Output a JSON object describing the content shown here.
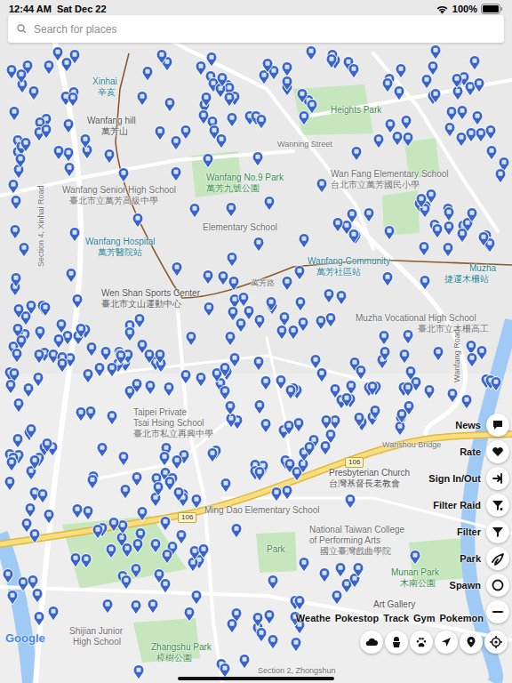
{
  "status_bar": {
    "time": "12:44 AM",
    "date": "Sat Dec 22",
    "battery": "100%"
  },
  "search": {
    "placeholder": "Search for places"
  },
  "map": {
    "labels": [
      {
        "text": "Xinhai",
        "kind": "station"
      },
      {
        "text": "辛亥",
        "kind": "station"
      },
      {
        "text": "Wanfang hill",
        "kind": "place"
      },
      {
        "text": "萬芳山",
        "kind": "place"
      },
      {
        "text": "Wanfang Senior High School",
        "kind": "school"
      },
      {
        "text": "臺北市立萬芳高級中學",
        "kind": "school"
      },
      {
        "text": "Wanfang No.9 Park",
        "kind": "park"
      },
      {
        "text": "萬芳九號公園",
        "kind": "park"
      },
      {
        "text": "Heights Park",
        "kind": "park"
      },
      {
        "text": "Wanning Street",
        "kind": "road"
      },
      {
        "text": "Wan Fang Elementary School",
        "kind": "school"
      },
      {
        "text": "台北市立萬芳國民小學",
        "kind": "school"
      },
      {
        "text": "Elementary School",
        "kind": "school"
      },
      {
        "text": "Wanfang Hospital",
        "kind": "station"
      },
      {
        "text": "萬芳醫院站",
        "kind": "station"
      },
      {
        "text": "Wanfang Community",
        "kind": "station"
      },
      {
        "text": "萬芳社區站",
        "kind": "station"
      },
      {
        "text": "Muzha",
        "kind": "station"
      },
      {
        "text": "捷運木柵站",
        "kind": "station"
      },
      {
        "text": "萬芳路",
        "kind": "road"
      },
      {
        "text": "Wen Shan Sports Center",
        "kind": "place"
      },
      {
        "text": "臺北市文山運動中心",
        "kind": "place"
      },
      {
        "text": "Muzha Vocational High School",
        "kind": "school"
      },
      {
        "text": "臺北市立木柵高工",
        "kind": "school"
      },
      {
        "text": "Taipei Private",
        "kind": "school"
      },
      {
        "text": "Tsai Hsing School",
        "kind": "school"
      },
      {
        "text": "臺北市私立再興中學",
        "kind": "school"
      },
      {
        "text": "Wanshou Bridge",
        "kind": "road"
      },
      {
        "text": "106",
        "kind": "shield"
      },
      {
        "text": "106",
        "kind": "shield"
      },
      {
        "text": "Presbyterian Church",
        "kind": "place"
      },
      {
        "text": "台灣基督長老教會",
        "kind": "place"
      },
      {
        "text": "Ming Dao Elementary School",
        "kind": "school"
      },
      {
        "text": "National Taiwan College",
        "kind": "school"
      },
      {
        "text": "of Performing Arts",
        "kind": "school"
      },
      {
        "text": "國立臺灣戲曲學院",
        "kind": "school"
      },
      {
        "text": "Park",
        "kind": "park"
      },
      {
        "text": "Munan Park",
        "kind": "park"
      },
      {
        "text": "木南公園",
        "kind": "park"
      },
      {
        "text": "Art Gallery",
        "kind": "place"
      },
      {
        "text": "Shijian Junior",
        "kind": "school"
      },
      {
        "text": "High School",
        "kind": "school"
      },
      {
        "text": "Zhangshu Park",
        "kind": "park"
      },
      {
        "text": "樟樹公園",
        "kind": "park"
      },
      {
        "text": "Section 2, Zhongshun",
        "kind": "road"
      },
      {
        "text": "Section 4, Xinhai Road",
        "kind": "road-v"
      },
      {
        "text": "Wanfang Road",
        "kind": "road-v"
      }
    ],
    "attribution": "Google"
  },
  "side_buttons": [
    {
      "label": "News"
    },
    {
      "label": "Rate"
    },
    {
      "label": "Sign In/Out"
    },
    {
      "label": "Filter Raid"
    },
    {
      "label": "Filter"
    },
    {
      "label": "Park"
    },
    {
      "label": "Spawn"
    }
  ],
  "bottom_buttons": [
    {
      "label": "Weathe"
    },
    {
      "label": "Pokestop"
    },
    {
      "label": "Track"
    },
    {
      "label": "Gym"
    },
    {
      "label": "Pokemon"
    }
  ]
}
